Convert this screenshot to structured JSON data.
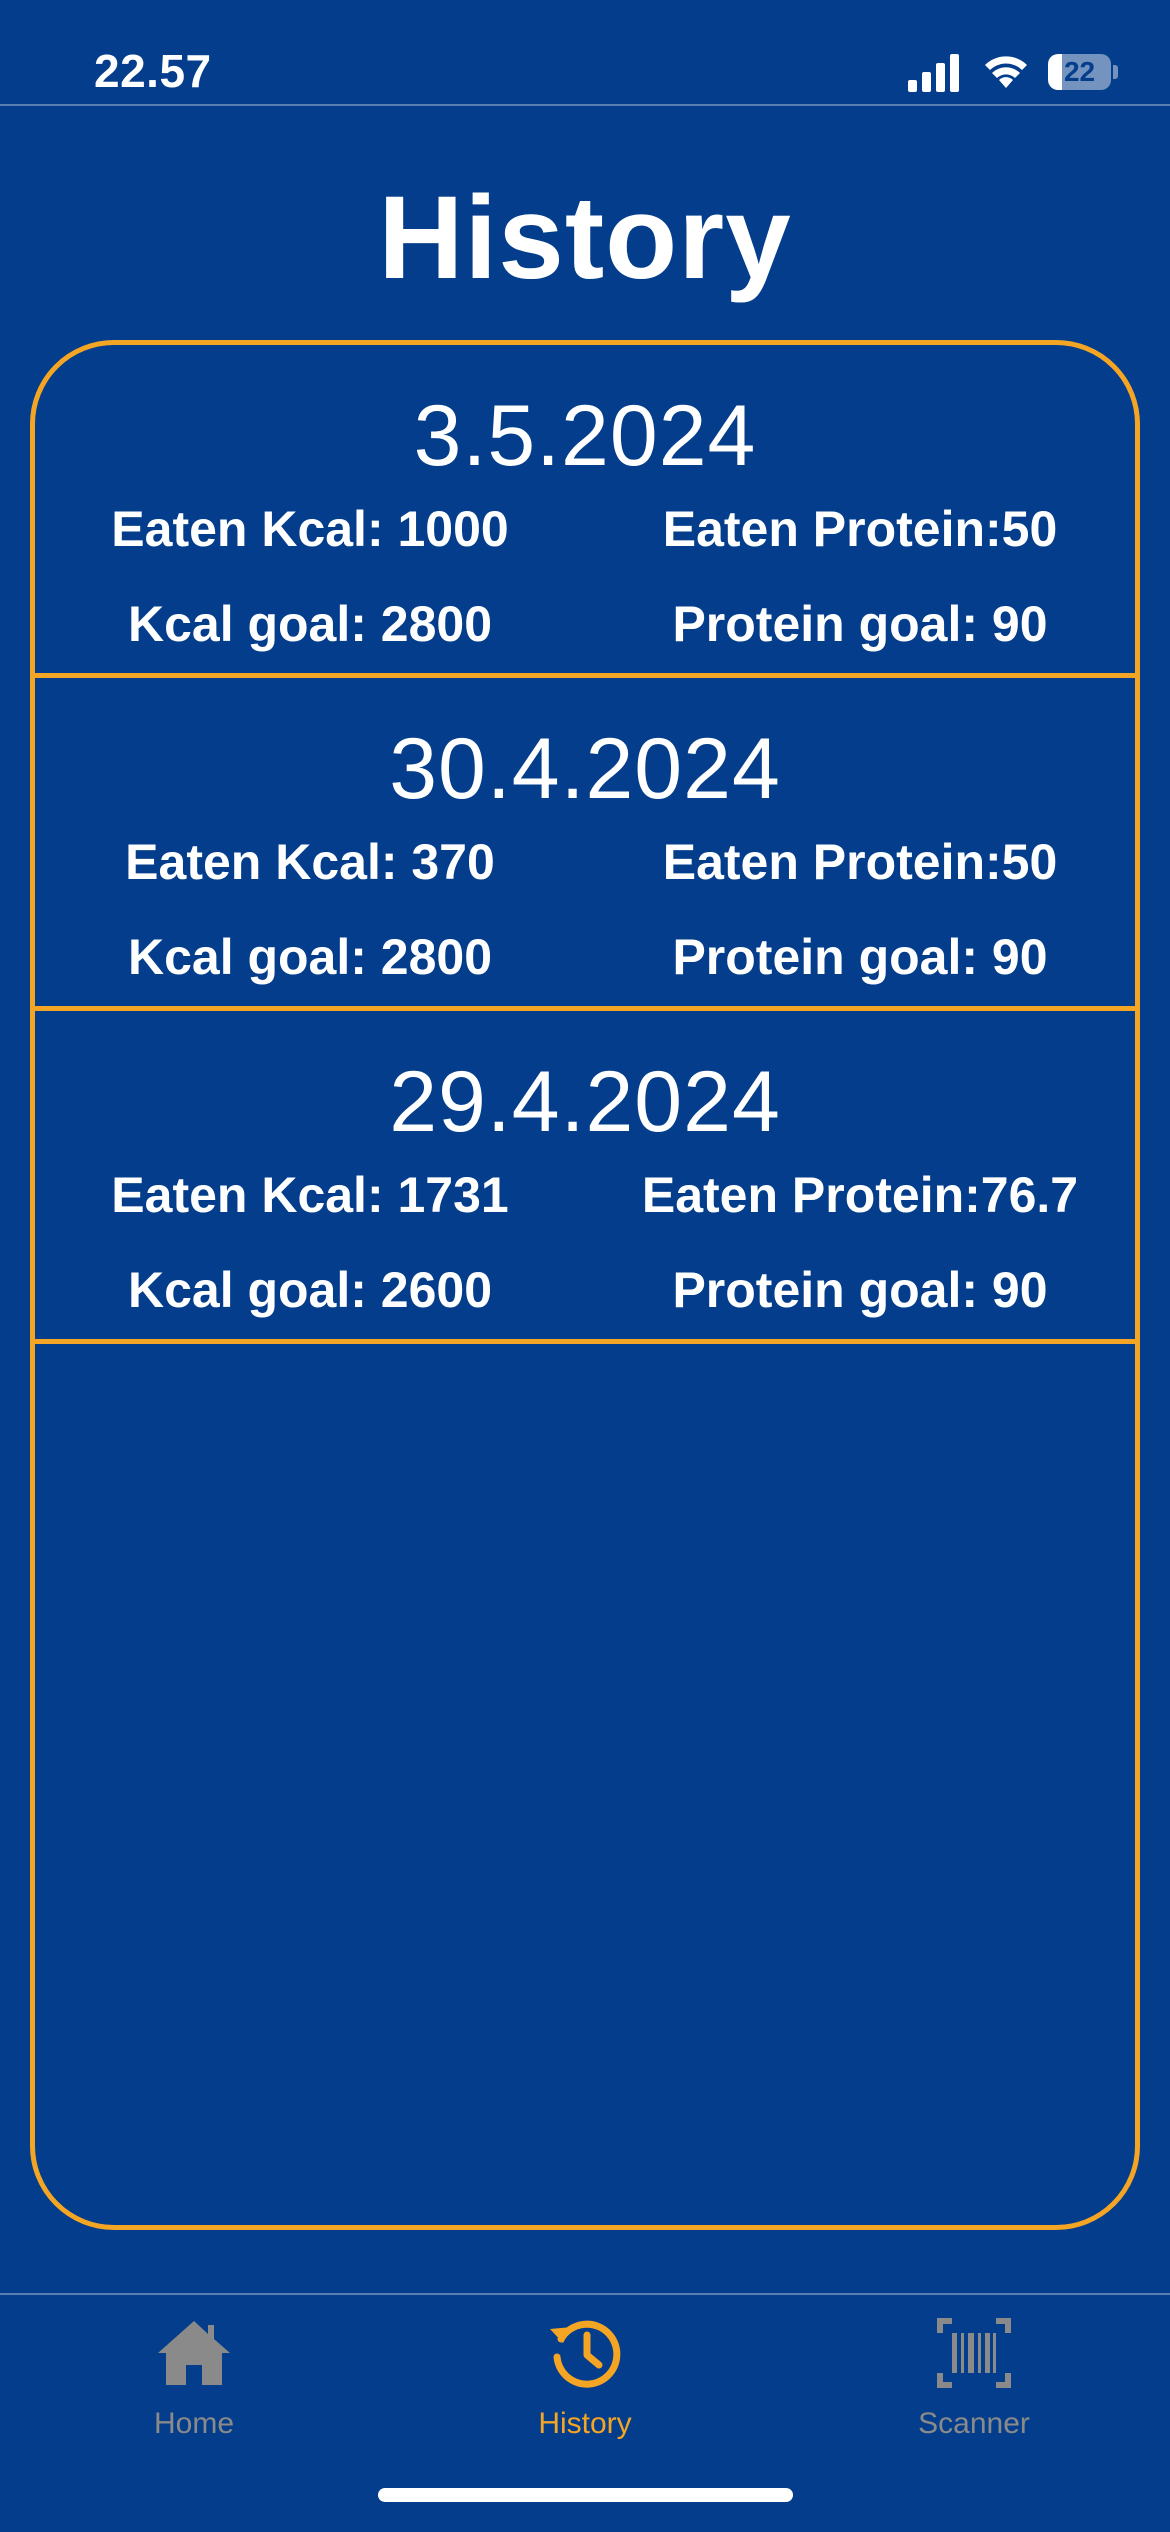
{
  "status_bar": {
    "time": "22.57",
    "battery_level": "22",
    "battery_fraction": 0.22
  },
  "page": {
    "title": "History"
  },
  "entries": [
    {
      "date": "3.5.2024",
      "eaten_kcal": "Eaten Kcal: 1000",
      "eaten_protein": "Eaten Protein:50",
      "kcal_goal": "Kcal goal: 2800",
      "protein_goal": "Protein goal: 90"
    },
    {
      "date": "30.4.2024",
      "eaten_kcal": "Eaten Kcal: 370",
      "eaten_protein": "Eaten Protein:50",
      "kcal_goal": "Kcal goal: 2800",
      "protein_goal": "Protein goal: 90"
    },
    {
      "date": "29.4.2024",
      "eaten_kcal": "Eaten Kcal: 1731",
      "eaten_protein": "Eaten Protein:76.7",
      "kcal_goal": "Kcal goal: 2600",
      "protein_goal": "Protein goal: 90"
    }
  ],
  "tab_bar": {
    "tabs": [
      {
        "label": "Home",
        "icon": "house-icon",
        "active": false
      },
      {
        "label": "History",
        "icon": "history-clock-icon",
        "active": true
      },
      {
        "label": "Scanner",
        "icon": "barcode-scanner-icon",
        "active": false
      }
    ]
  },
  "colors": {
    "background": "#033d8b",
    "accent": "#f5a524",
    "inactive_tab": "#8a8a8a",
    "text": "#ffffff"
  }
}
